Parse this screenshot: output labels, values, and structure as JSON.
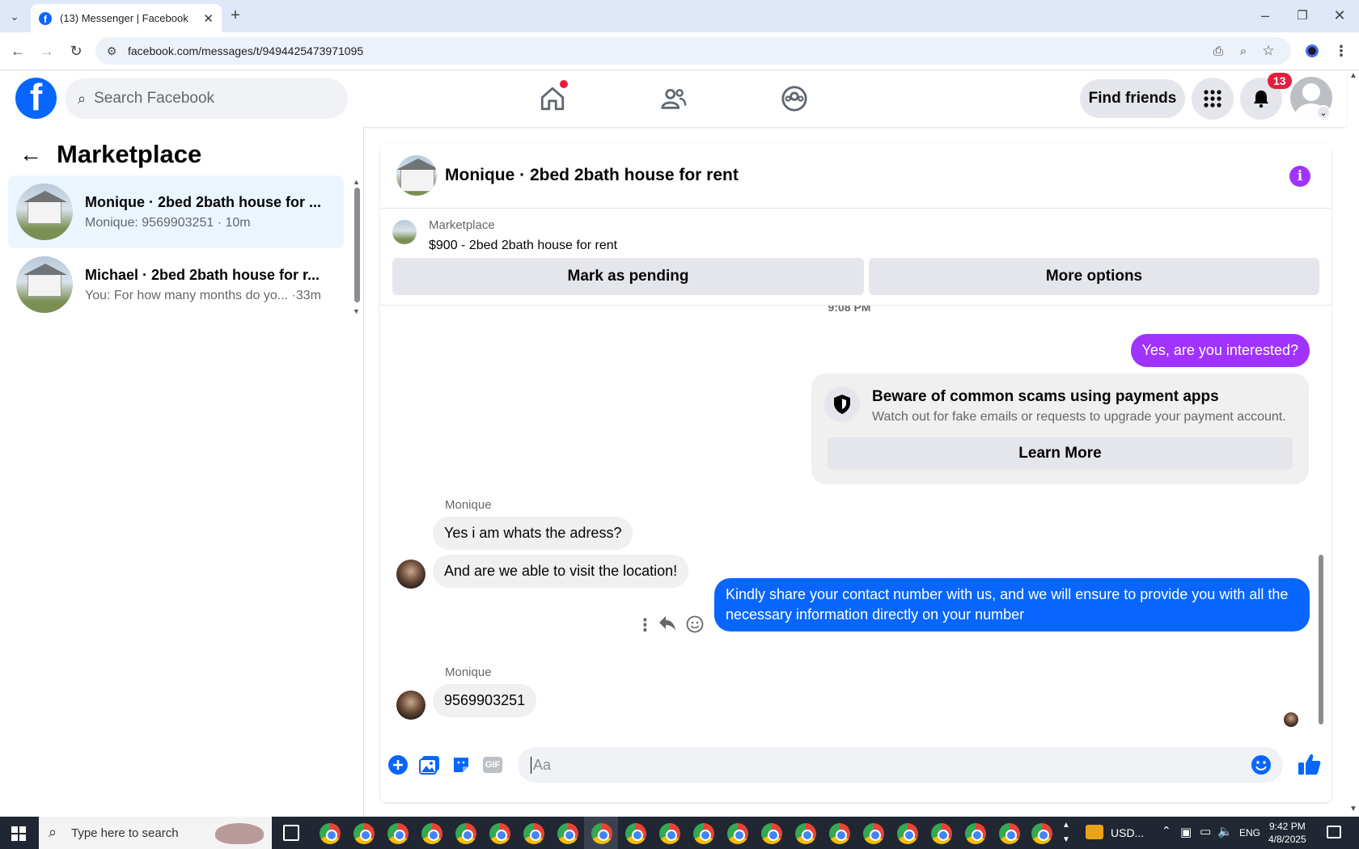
{
  "browser": {
    "tab_title": "(13) Messenger | Facebook",
    "url": "facebook.com/messages/t/9494425473971095"
  },
  "fb": {
    "search_placeholder": "Search Facebook",
    "find_friends": "Find friends",
    "notification_count": "13"
  },
  "sidebar": {
    "title": "Marketplace",
    "conversations": [
      {
        "name": "Monique · 2bed 2bath house for ...",
        "preview": "Monique: 9569903251 · 10m"
      },
      {
        "name": "Michael · 2bed 2bath house for r...",
        "preview": "You: For how many months do yo... ·33m"
      }
    ]
  },
  "chat": {
    "title": "Monique · 2bed 2bath house for rent",
    "listing_category": "Marketplace",
    "listing_title": "$900 - 2bed 2bath house for rent",
    "mark_pending": "Mark as pending",
    "more_options": "More options",
    "timestamp": "9:08 PM",
    "messages": {
      "m1": "Yes, are you interested?",
      "scam_title": "Beware of common scams using payment apps",
      "scam_desc": "Watch out for fake emails or requests to upgrade your payment account.",
      "learn_more": "Learn More",
      "sender1": "Monique",
      "m2": "Yes i am whats the adress?",
      "m3": "And are we able to visit the location!",
      "m4": "Kindly share your contact number with us, and we will ensure to provide you with all the necessary information directly on your number",
      "sender2": "Monique",
      "m5": "9569903251"
    },
    "composer_placeholder": "Aa"
  },
  "taskbar": {
    "search_placeholder": "Type here to search",
    "currency": "USD...",
    "lang": "ENG",
    "time": "9:42 PM",
    "date": "4/8/2025"
  },
  "colors": {
    "fb_blue": "#0866ff",
    "purple": "#a033ff",
    "badge_red": "#e41e3f"
  }
}
